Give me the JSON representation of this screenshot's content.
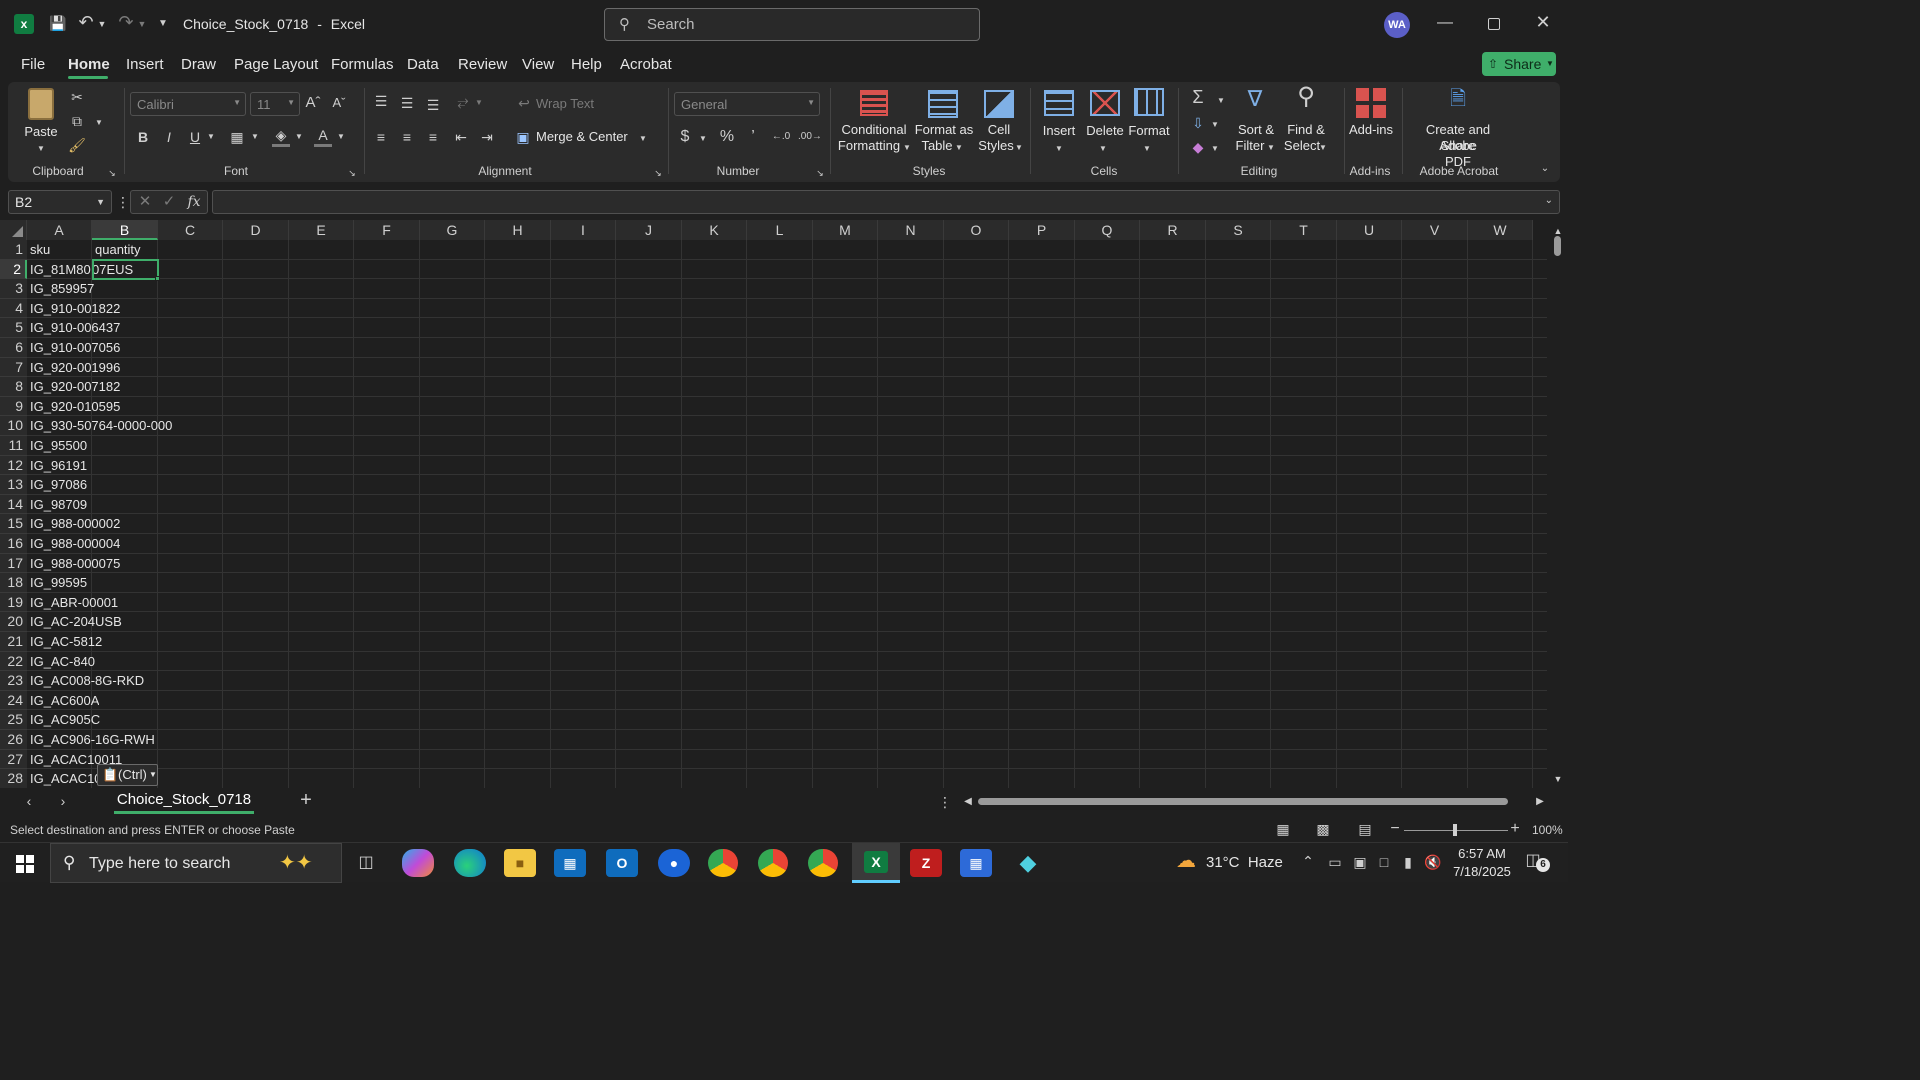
{
  "titlebar": {
    "filename": "Choice_Stock_0718",
    "separator": "-",
    "app": "Excel",
    "search_placeholder": "Search",
    "avatar": "WA"
  },
  "menu": [
    "File",
    "Home",
    "Insert",
    "Draw",
    "Page Layout",
    "Formulas",
    "Data",
    "Review",
    "View",
    "Help",
    "Acrobat"
  ],
  "share_label": "Share",
  "ribbon": {
    "clipboard": {
      "paste": "Paste",
      "group": "Clipboard"
    },
    "font": {
      "name": "Calibri",
      "size": "11",
      "group": "Font"
    },
    "alignment": {
      "wrap": "Wrap Text",
      "merge": "Merge & Center",
      "group": "Alignment"
    },
    "number": {
      "format": "General",
      "group": "Number"
    },
    "styles": {
      "cond1": "Conditional",
      "cond2": "Formatting",
      "fmt1": "Format as",
      "fmt2": "Table",
      "cell1": "Cell",
      "cell2": "Styles",
      "group": "Styles"
    },
    "cells": {
      "insert": "Insert",
      "delete": "Delete",
      "format": "Format",
      "group": "Cells"
    },
    "editing": {
      "sort1": "Sort &",
      "sort2": "Filter",
      "find1": "Find &",
      "find2": "Select",
      "group": "Editing"
    },
    "addins": {
      "label": "Add-ins",
      "group": "Add-ins"
    },
    "acrobat": {
      "line1": "Create and Share",
      "line2": "Adobe PDF",
      "group": "Adobe Acrobat"
    }
  },
  "formula": {
    "namebox": "B2",
    "fx": "fx",
    "value": ""
  },
  "columns": [
    "A",
    "B",
    "C",
    "D",
    "E",
    "F",
    "G",
    "H",
    "I",
    "J",
    "K",
    "L",
    "M",
    "N",
    "O",
    "P",
    "Q",
    "R",
    "S",
    "T",
    "U",
    "V",
    "W"
  ],
  "rows": [
    {
      "n": "1",
      "a": "sku",
      "b": "quantity"
    },
    {
      "n": "2",
      "a": "IG_81M80",
      "b": "07EUS"
    },
    {
      "n": "3",
      "a": "IG_859957",
      "b": ""
    },
    {
      "n": "4",
      "a": "IG_910-001822",
      "b": ""
    },
    {
      "n": "5",
      "a": "IG_910-006437",
      "b": ""
    },
    {
      "n": "6",
      "a": "IG_910-007056",
      "b": ""
    },
    {
      "n": "7",
      "a": "IG_920-001996",
      "b": ""
    },
    {
      "n": "8",
      "a": "IG_920-007182",
      "b": ""
    },
    {
      "n": "9",
      "a": "IG_920-010595",
      "b": ""
    },
    {
      "n": "10",
      "a": "IG_930-50764-0000-000",
      "b": ""
    },
    {
      "n": "11",
      "a": "IG_95500",
      "b": ""
    },
    {
      "n": "12",
      "a": "IG_96191",
      "b": ""
    },
    {
      "n": "13",
      "a": "IG_97086",
      "b": ""
    },
    {
      "n": "14",
      "a": "IG_98709",
      "b": ""
    },
    {
      "n": "15",
      "a": "IG_988-000002",
      "b": ""
    },
    {
      "n": "16",
      "a": "IG_988-000004",
      "b": ""
    },
    {
      "n": "17",
      "a": "IG_988-000075",
      "b": ""
    },
    {
      "n": "18",
      "a": "IG_99595",
      "b": ""
    },
    {
      "n": "19",
      "a": "IG_ABR-00001",
      "b": ""
    },
    {
      "n": "20",
      "a": "IG_AC-204USB",
      "b": ""
    },
    {
      "n": "21",
      "a": "IG_AC-5812",
      "b": ""
    },
    {
      "n": "22",
      "a": "IG_AC-840",
      "b": ""
    },
    {
      "n": "23",
      "a": "IG_AC008-8G-RKD",
      "b": ""
    },
    {
      "n": "24",
      "a": "IG_AC600A",
      "b": ""
    },
    {
      "n": "25",
      "a": "IG_AC905C",
      "b": ""
    },
    {
      "n": "26",
      "a": "IG_AC906-16G-RWH",
      "b": ""
    },
    {
      "n": "27",
      "a": "IG_ACAC10011",
      "b": ""
    },
    {
      "n": "28",
      "a": "IG_ACAC10",
      "b": ""
    }
  ],
  "paste_options": "(Ctrl)",
  "sheet_tab": "Choice_Stock_0718",
  "status": {
    "message": "Select destination and press ENTER or choose Paste",
    "zoom": "100%"
  },
  "taskbar": {
    "search_placeholder": "Type here to search",
    "weather": "31°C  Haze",
    "time": "6:57 AM",
    "date": "7/18/2025",
    "notifications": "6"
  },
  "colors": {
    "accent": "#3fae6a",
    "excel_green": "#107c41",
    "selection": "#3fae6a"
  }
}
